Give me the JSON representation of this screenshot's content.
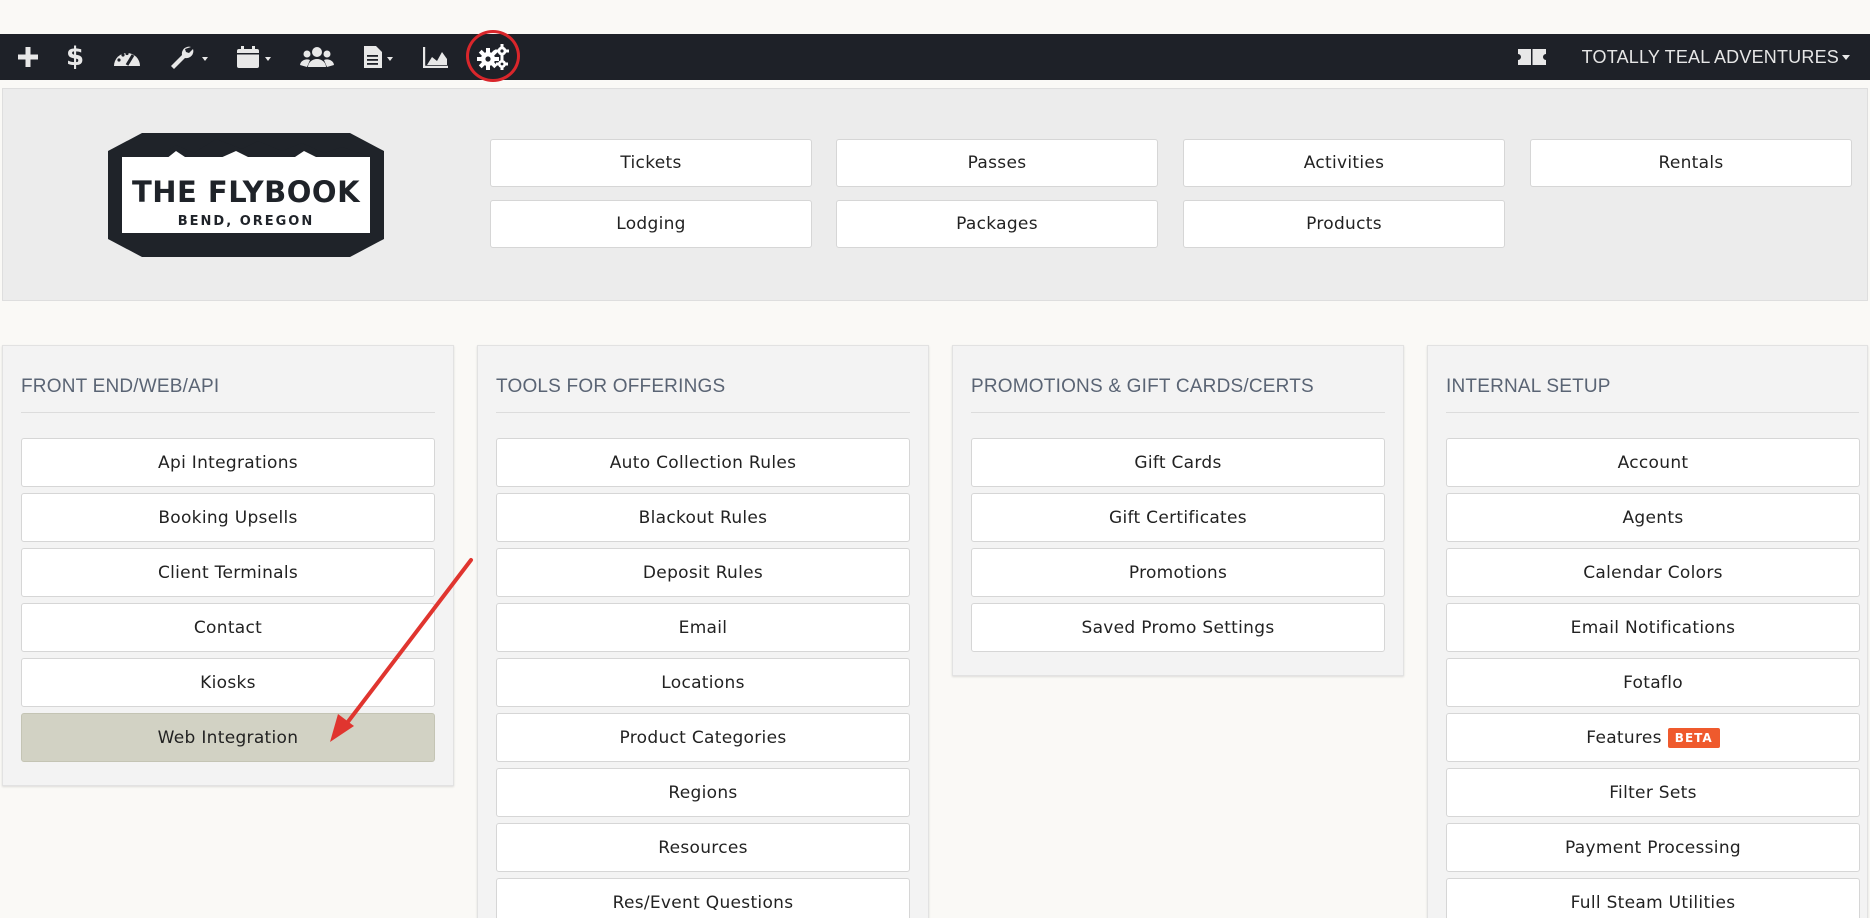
{
  "topbar": {
    "icons": [
      "plus-icon",
      "dollar-icon",
      "dashboard-icon",
      "wrench-icon",
      "calendar-icon",
      "users-icon",
      "document-icon",
      "area-chart-icon",
      "gears-icon"
    ],
    "notice_icon": "ticket-icon",
    "company_name": "TOTALLY TEAL ADVENTURES"
  },
  "logo": {
    "title": "THE FLYBOOK",
    "subtitle": "BEND, OREGON"
  },
  "offerings": [
    "Tickets",
    "Passes",
    "Activities",
    "Rentals",
    "Lodging",
    "Packages",
    "Products"
  ],
  "panels": [
    {
      "title": "FRONT END/WEB/API",
      "items": [
        "Api Integrations",
        "Booking Upsells",
        "Client Terminals",
        "Contact",
        "Kiosks",
        "Web Integration"
      ]
    },
    {
      "title": "TOOLS FOR OFFERINGS",
      "items": [
        "Auto Collection Rules",
        "Blackout Rules",
        "Deposit Rules",
        "Email",
        "Locations",
        "Product Categories",
        "Regions",
        "Resources",
        "Res/Event Questions"
      ]
    },
    {
      "title": "PROMOTIONS & GIFT CARDS/CERTS",
      "items": [
        "Gift Cards",
        "Gift Certificates",
        "Promotions",
        "Saved Promo Settings"
      ]
    },
    {
      "title": "INTERNAL SETUP",
      "items": [
        "Account",
        "Agents",
        "Calendar Colors",
        "Email Notifications",
        "Fotaflo",
        "Features",
        "Filter Sets",
        "Payment Processing",
        "Full Steam Utilities"
      ],
      "badge": "BETA"
    }
  ],
  "colors": {
    "topbar": "#1e2128",
    "highlight_ring": "#d9262b",
    "annotation_arrow": "#e0352f",
    "active_item": "#d2d2c4",
    "beta_badge": "#ef5a2d"
  }
}
